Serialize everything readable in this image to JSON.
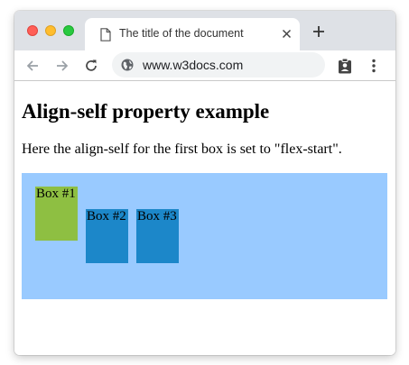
{
  "browser": {
    "tab_title": "The title of the document",
    "url": "www.w3docs.com",
    "icons": {
      "tab": "document-icon",
      "close": "close-icon",
      "new_tab": "plus-icon",
      "back": "back-arrow-icon",
      "forward": "forward-arrow-icon",
      "reload": "reload-icon",
      "site": "globe-icon",
      "extension": "clipboard-account-icon",
      "menu": "kebab-menu-icon"
    }
  },
  "page": {
    "heading": "Align-self property example",
    "text": "Here the align-self for the first box is set to \"flex-start\".",
    "container_color": "#99caff",
    "boxes": [
      {
        "label": "Box #1",
        "color": "#8ebf42"
      },
      {
        "label": "Box #2",
        "color": "#1c87c9"
      },
      {
        "label": "Box #3",
        "color": "#1c87c9"
      }
    ]
  }
}
